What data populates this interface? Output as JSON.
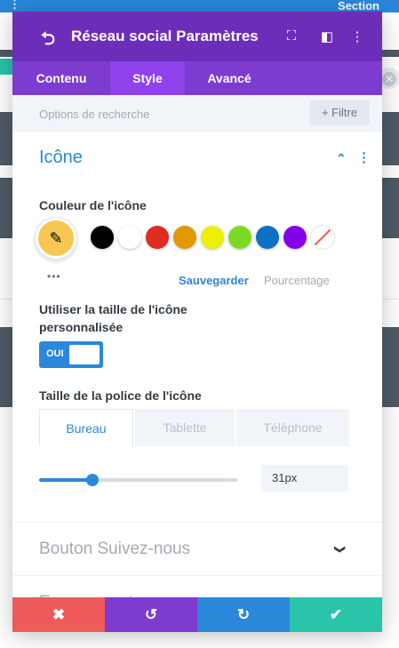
{
  "background": {
    "section_label": "Section",
    "menu_dots": "⋮",
    "close_glyph": "✕"
  },
  "modal": {
    "back_glyph": "⮌",
    "title": "Réseau social Paramètres",
    "header_icons": {
      "expand": "⛶",
      "sidebar": "◧",
      "more": "⋮"
    },
    "tabs": [
      {
        "label": "Contenu"
      },
      {
        "label": "Style"
      },
      {
        "label": "Avancé"
      }
    ],
    "search_placeholder": "Options de recherche",
    "filter_label": "+ Filtre",
    "section": {
      "title": "Icône",
      "caret": "⌃",
      "more": "⋮"
    },
    "icon_color": {
      "label": "Couleur de l'icône",
      "selected_color": "#f6c751",
      "picker_glyph": "✎",
      "dots": "•••",
      "swatches": [
        {
          "color": "#000000"
        },
        {
          "color": "#ffffff"
        },
        {
          "color": "#e02b20"
        },
        {
          "color": "#e09900"
        },
        {
          "color": "#edf000"
        },
        {
          "color": "#7cda24"
        },
        {
          "color": "#0c71c3"
        },
        {
          "color": "#8300e9"
        },
        {
          "color": "none"
        }
      ],
      "save_label": "Sauvegarder",
      "percent_label": "Pourcentage"
    },
    "custom_size": {
      "label_line1": "Utiliser la taille de l'icône",
      "label_line2": "personnalisée",
      "toggle_label": "OUI",
      "value": true
    },
    "font_size": {
      "label": "Taille de la police de l'icône",
      "device_tabs": [
        {
          "label": "Bureau"
        },
        {
          "label": "Tablette"
        },
        {
          "label": "Téléphone"
        }
      ],
      "value_text": "31px",
      "slider_fraction": 0.27
    },
    "collapsed_sections": [
      {
        "title": "Bouton Suivez-nous",
        "chevron": "❯"
      },
      {
        "title": "Espacement",
        "chevron": "❯"
      }
    ],
    "footer": {
      "cancel": "✖",
      "undo": "↺",
      "redo": "↻",
      "save": "✔",
      "colors": {
        "cancel": "#ef5a5a",
        "undo": "#7d3bcf",
        "redo": "#2b87da",
        "save": "#29c4a9"
      }
    }
  }
}
